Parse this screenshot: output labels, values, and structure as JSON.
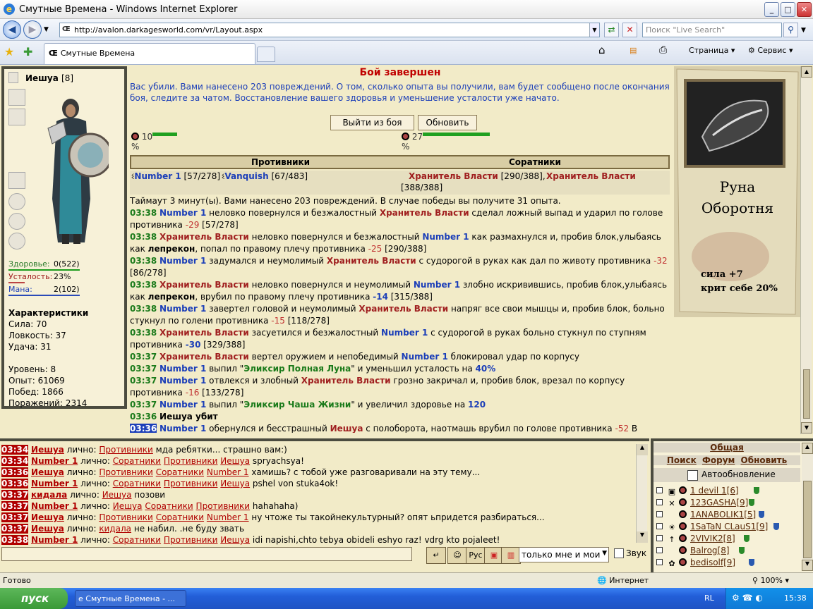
{
  "window": {
    "title": "Смутные Времена - Windows Internet Explorer",
    "minimize": "_",
    "maximize": "□",
    "close": "✕"
  },
  "address": {
    "url": "http://avalon.darkagesworld.com/vr/Layout.aspx",
    "search_placeholder": "Поиск \"Live Search\""
  },
  "tabs": {
    "active": "Смутные Времена"
  },
  "toolbar": {
    "page": "Страница",
    "service": "Сервис"
  },
  "character": {
    "name": "Иешуа",
    "level": "[8]",
    "health_label": "Здоровье:",
    "health_value": "0(522)",
    "fatigue_label": "Усталость:",
    "fatigue_value": "23%",
    "mana_label": "Мана:",
    "mana_value": "2(102)",
    "char_title": "Характеристики",
    "strength": "Сила: 70",
    "agility": "Ловкость: 37",
    "luck": "Удача: 31",
    "level_line": "Уровень: 8",
    "exp_line": "Опыт: 61069",
    "wins_line": "Побед: 1866",
    "losses_line": "Поражений: 2314",
    "fatigue_fill": 0.23,
    "mana_fill": 0.02,
    "health_fill": 0.0
  },
  "battle": {
    "title": "Бой завершен",
    "info": "Вас убили. Вами нанесено 203 повреждений. О том, сколько опыта вы получили, вам будет сообщено после окончания боя, следите за чатом. Восстановление вашего здоровья и уменьшение усталости уже начато.",
    "exit_button": "Выйти из боя",
    "refresh_button": "Обновить",
    "left_hp": "10",
    "right_hp": "27",
    "pct": "%",
    "left_fill": 0.1,
    "right_fill": 0.27,
    "foes_header": "Противники",
    "allies_header": "Соратники",
    "foe1": "Number 1",
    "foe1_hp": "[57/278]",
    "foe2": "Vanquish",
    "foe2_hp": "[67/483]",
    "ally1": "Хранитель Власти",
    "ally1_hp": "[290/388],",
    "ally2": "Хранитель Власти",
    "ally2_hp": "[388/388]",
    "timeout": "Таймаут 3 минут(ы). Вами нанесено 203 повреждений. В случае победы вы получите 31 опыта."
  },
  "log": [
    {
      "t": "03:38",
      "parts": [
        [
          "b",
          "Number 1"
        ],
        [
          "n",
          " неловко повернулся и безжалостный "
        ],
        [
          "r",
          "Хранитель Власти"
        ],
        [
          "n",
          " сделал ложный выпад и ударил по голове противника "
        ],
        [
          "d",
          "-29"
        ],
        [
          "n",
          " [57/278]"
        ]
      ]
    },
    {
      "t": "03:38",
      "parts": [
        [
          "r",
          "Хранитель Власти"
        ],
        [
          "n",
          " неловко повернулся и безжалостный "
        ],
        [
          "b",
          "Number 1"
        ],
        [
          "n",
          " как размахнулся и, пробив блок,улыбаясь как "
        ],
        [
          "k",
          "лепрекон"
        ],
        [
          "n",
          ", попал по правому плечу противника "
        ],
        [
          "d",
          "-25"
        ],
        [
          "n",
          " [290/388]"
        ]
      ]
    },
    {
      "t": "03:38",
      "parts": [
        [
          "b",
          "Number 1"
        ],
        [
          "n",
          " задумался и неумолимый "
        ],
        [
          "r",
          "Хранитель Власти"
        ],
        [
          "n",
          " с судорогой в руках как дал по животу противника "
        ],
        [
          "d",
          "-32"
        ],
        [
          "n",
          " [86/278]"
        ]
      ]
    },
    {
      "t": "03:38",
      "parts": [
        [
          "r",
          "Хранитель Власти"
        ],
        [
          "n",
          " неловко повернулся и неумолимый "
        ],
        [
          "b",
          "Number 1"
        ],
        [
          "n",
          " злобно искривившись, пробив блок,улыбаясь как "
        ],
        [
          "k",
          "лепрекон"
        ],
        [
          "n",
          ", врубил по правому плечу противника "
        ],
        [
          "x",
          "-14"
        ],
        [
          "n",
          " [315/388]"
        ]
      ]
    },
    {
      "t": "03:38",
      "parts": [
        [
          "b",
          "Number 1"
        ],
        [
          "n",
          " завертел головой и неумолимый "
        ],
        [
          "r",
          "Хранитель Власти"
        ],
        [
          "n",
          " напряг все свои мышцы и, пробив блок, больно стукнул по голени противника "
        ],
        [
          "d",
          "-15"
        ],
        [
          "n",
          " [118/278]"
        ]
      ]
    },
    {
      "t": "03:38",
      "parts": [
        [
          "r",
          "Хранитель Власти"
        ],
        [
          "n",
          " засуетился и безжалостный "
        ],
        [
          "b",
          "Number 1"
        ],
        [
          "n",
          " с судорогой в руках больно стукнул по ступням противника "
        ],
        [
          "x",
          "-30"
        ],
        [
          "n",
          " [329/388]"
        ]
      ]
    },
    {
      "t": "03:37",
      "parts": [
        [
          "r",
          "Хранитель Власти"
        ],
        [
          "n",
          " вертел оружием и непобедимый "
        ],
        [
          "b",
          "Number 1"
        ],
        [
          "n",
          " блокировал удар по корпусу"
        ]
      ]
    },
    {
      "t": "03:37",
      "parts": [
        [
          "b",
          "Number 1"
        ],
        [
          "n",
          " выпил \""
        ],
        [
          "g",
          "Эликсир Полная Луна"
        ],
        [
          "n",
          "\" и уменьшил усталость на "
        ],
        [
          "x",
          "40%"
        ]
      ]
    },
    {
      "t": "03:37",
      "parts": [
        [
          "b",
          "Number 1"
        ],
        [
          "n",
          " отвлекся и злобный "
        ],
        [
          "r",
          "Хранитель Власти"
        ],
        [
          "n",
          " грозно закричал и, пробив блок, врезал по корпусу противника "
        ],
        [
          "d",
          "-16"
        ],
        [
          "n",
          " [133/278]"
        ]
      ]
    },
    {
      "t": "03:37",
      "parts": [
        [
          "b",
          "Number 1"
        ],
        [
          "n",
          " выпил \""
        ],
        [
          "g",
          "Эликсир Чаша Жизни"
        ],
        [
          "n",
          "\" и увеличил здоровье на "
        ],
        [
          "x",
          "120"
        ]
      ]
    },
    {
      "t": "03:36",
      "parts": [
        [
          "k",
          "Иешуа убит"
        ]
      ]
    },
    {
      "t": "03:36",
      "hi": true,
      "parts": [
        [
          "b",
          "Number 1"
        ],
        [
          "n",
          " обернулся и бесстрашный "
        ],
        [
          "r",
          "Иешуа"
        ],
        [
          "n",
          " с полоборота, наотмашь врубил по голове противника "
        ],
        [
          "d",
          "-52"
        ],
        [
          "n",
          " В результате"
        ]
      ]
    }
  ],
  "rune": {
    "title1": "Руна",
    "title2": "Оборотня",
    "stat1": "сила  +7",
    "stat2": "крит себе 20%"
  },
  "chat": [
    {
      "t": "03:34",
      "n": "Иешуа",
      "w": " лично: ",
      "l": [
        "Противники"
      ],
      "m": " мда ребятки... страшно вам:)"
    },
    {
      "t": "03:34",
      "n": "Number 1",
      "w": " лично: ",
      "l": [
        "Соратники",
        "Противники",
        "Иешуа"
      ],
      "m": " spryachsya!"
    },
    {
      "t": "03:36",
      "n": "Иешуа",
      "w": " лично: ",
      "l": [
        "Противники",
        "Соратники",
        "Number 1"
      ],
      "m": " хамишь? с тобой уже разговаривали на эту тему..."
    },
    {
      "t": "03:36",
      "n": "Number 1",
      "w": " лично: ",
      "l": [
        "Соратники",
        "Противники",
        "Иешуа"
      ],
      "m": " pshel von stuka4ok!"
    },
    {
      "t": "03:37",
      "n": "кидала",
      "w": " лично: ",
      "l": [
        "Иешуа"
      ],
      "m": " позови"
    },
    {
      "t": "03:37",
      "n": "Number 1",
      "w": " лично: ",
      "l": [
        "Иешуа",
        "Соратники",
        "Противники"
      ],
      "m": " hahahaha)"
    },
    {
      "t": "03:37",
      "n": "Иешуа",
      "w": " лично: ",
      "l": [
        "Противники",
        "Соратники",
        "Number 1"
      ],
      "m": " ну чтоже ты такойнекультурный? опят ьпридется разбираться..."
    },
    {
      "t": "03:37",
      "n": "Иешуа",
      "w": " лично: ",
      "l": [
        "кидала"
      ],
      "m": " не набил. .не буду звать"
    },
    {
      "t": "03:38",
      "n": "Number 1",
      "w": " лично: ",
      "l": [
        "Соратники",
        "Противники",
        "Иешуа"
      ],
      "m": " idi napishi,chto tebya obideli eshyo raz! vdrg kto pojaleet!"
    }
  ],
  "chat_controls": {
    "select": "только мне и мои",
    "sound": "Звук"
  },
  "online": {
    "tab": "Общая",
    "search": "Поиск",
    "forum": "Форум",
    "refresh": "Обновить",
    "auto": "Автообновление",
    "players": [
      {
        "name": "1 devil 1",
        "lvl": "[6]",
        "ic": "▣",
        "sh": "g"
      },
      {
        "name": "123GASHA",
        "lvl": "[9]",
        "ic": "✕",
        "sh": "g"
      },
      {
        "name": "1ANABOLIK1",
        "lvl": "[5]",
        "ic": "",
        "sh": "b"
      },
      {
        "name": "1SaTaN CLauS1",
        "lvl": "[9]",
        "ic": "☀",
        "sh": "b"
      },
      {
        "name": "2VIVIK2",
        "lvl": "[8]",
        "ic": "↑",
        "sh": "g"
      },
      {
        "name": "Balrog",
        "lvl": "[8]",
        "ic": "",
        "sh": "g"
      },
      {
        "name": "bedisolf",
        "lvl": "[9]",
        "ic": "✿",
        "sh": "b"
      }
    ]
  },
  "status": {
    "ready": "Готово",
    "zone": "Интернет",
    "zoom": "100%"
  },
  "taskbar": {
    "start": "пуск",
    "item": "Смутные Времена - ...",
    "lang": "RL",
    "clock": "15:38"
  }
}
